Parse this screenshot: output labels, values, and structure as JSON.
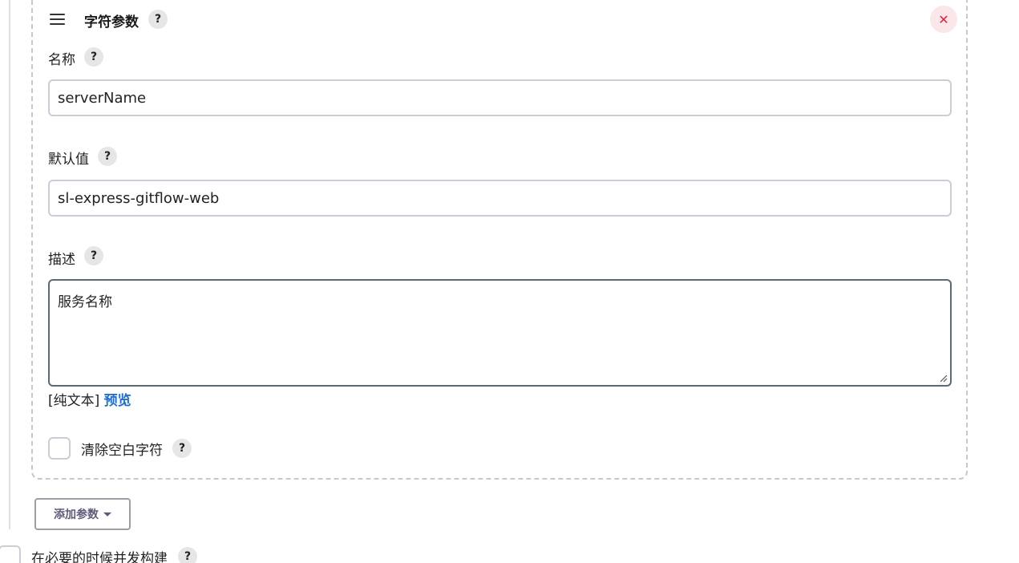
{
  "card": {
    "title": "字符参数",
    "help": "?",
    "delete_glyph": "✕"
  },
  "name_field": {
    "label": "名称",
    "help": "?",
    "value": "serverName"
  },
  "default_field": {
    "label": "默认值",
    "help": "?",
    "value": "sl-express-gitflow-web"
  },
  "description_field": {
    "label": "描述",
    "help": "?",
    "value": "服务名称",
    "format_text": "[纯文本]",
    "preview_link": "预览"
  },
  "trim_option": {
    "label": "清除空白字符",
    "help": "?",
    "checked": false
  },
  "add_param_button": {
    "label": "添加参数"
  },
  "concurrent_option": {
    "label": "在必要的时候并发构建",
    "help": "?",
    "checked": false
  },
  "colors": {
    "delete_bg": "#fbe6ea",
    "delete_fg": "#e0243c",
    "link": "#1f6fd1"
  }
}
